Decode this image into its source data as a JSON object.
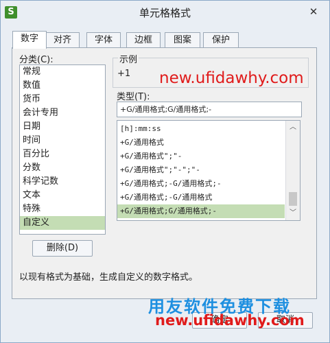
{
  "window": {
    "title": "单元格格式",
    "app_icon": "S"
  },
  "tabs": [
    "数字",
    "对齐",
    "字体",
    "边框",
    "图案",
    "保护"
  ],
  "category_label": "分类(C):",
  "categories": [
    "常规",
    "数值",
    "货币",
    "会计专用",
    "日期",
    "时间",
    "百分比",
    "分数",
    "科学记数",
    "文本",
    "特殊",
    "自定义"
  ],
  "sample": {
    "label": "示例",
    "value": "+1"
  },
  "watermark": {
    "top": "new.ufidawhy.com",
    "brand": "用友软件免费下载",
    "bottom": "new.ufidawhy.com"
  },
  "type": {
    "label": "类型(T):",
    "value": "+G/通用格式;G/通用格式;-"
  },
  "formats": [
    "[h]:mm:ss",
    "+G/通用格式",
    "+G/通用格式\";\"-",
    "+G/通用格式\";\"-\";\"-",
    "+G/通用格式;-G/通用格式;-",
    "+G/通用格式;-G/通用格式",
    "+G/通用格式;G/通用格式;-"
  ],
  "delete_button": "删除(D)",
  "description": "以现有格式为基础，生成自定义的数字格式。",
  "buttons": {
    "ok": "确定",
    "cancel": "取消"
  },
  "colors": {
    "selection": "#c4ddb4",
    "watermark_red": "#e01b1b",
    "watermark_blue": "#1d8fe0"
  }
}
